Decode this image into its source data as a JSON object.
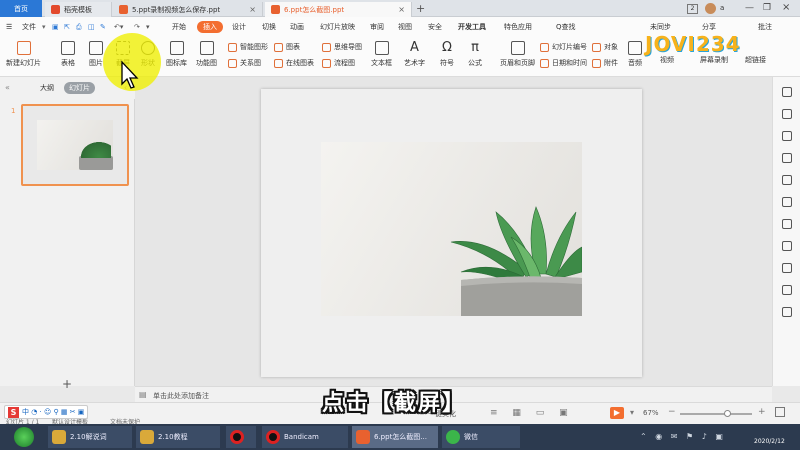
{
  "tabs": {
    "home": "首页",
    "docs": [
      {
        "label": "稻壳模板",
        "color": "#e34a2c"
      },
      {
        "label": "5.ppt录制视频怎么保存.ppt",
        "color": "#e8612f"
      },
      {
        "label": "6.ppt怎么截图.ppt",
        "color": "#e8612f",
        "active": true
      }
    ],
    "new_tab": "+",
    "window_badge": "2",
    "user_initial": "a"
  },
  "menu": {
    "file": "文件",
    "items": [
      "开始",
      "插入",
      "设计",
      "切换",
      "动画",
      "幻灯片放映",
      "审阅",
      "视图",
      "安全",
      "开发工具",
      "特色应用"
    ],
    "active": "插入",
    "search": "Q查找",
    "sync": "未同步",
    "share": "分享",
    "comment": "批注"
  },
  "ribbon": {
    "large": [
      {
        "label": "新建幻灯片",
        "icon": "new-slide-icon"
      },
      {
        "label": "表格",
        "icon": "table-icon"
      },
      {
        "label": "图片",
        "icon": "picture-icon"
      },
      {
        "label": "截屏",
        "icon": "screenshot-icon"
      },
      {
        "label": "形状",
        "icon": "shape-icon"
      },
      {
        "label": "图标库",
        "icon": "icon-library-icon"
      },
      {
        "label": "功能图",
        "icon": "function-chart-icon"
      }
    ],
    "small_col1": [
      "智能图形",
      "关系图"
    ],
    "small_col2": [
      "图表",
      "在线图表"
    ],
    "small_col3": [
      "思维导图",
      "流程图"
    ],
    "mid": [
      {
        "label": "文本框",
        "icon": "textbox-icon"
      },
      {
        "label": "艺术字",
        "icon": "wordart-icon"
      },
      {
        "label": "符号",
        "icon": "omega-icon"
      },
      {
        "label": "公式",
        "icon": "pi-icon"
      },
      {
        "label": "页眉和页脚",
        "icon": "header-footer-icon"
      }
    ],
    "small_col4": [
      "幻灯片编号",
      "日期和时间"
    ],
    "small_col5": [
      "对象",
      "附件"
    ],
    "right": [
      {
        "label": "音频",
        "icon": "audio-icon"
      },
      {
        "label": "视频",
        "icon": "video-icon"
      },
      {
        "label": "屏幕录制",
        "icon": "screen-record-icon"
      },
      {
        "label": "超链接",
        "icon": "hyperlink-icon"
      }
    ]
  },
  "panel": {
    "outline_tab": "大纲",
    "slides_tab": "幻灯片",
    "slide_number": "1",
    "add_button": "+"
  },
  "notes": {
    "placeholder": "单击此处添加备注"
  },
  "status": {
    "slide_info": "幻灯片 1 / 1",
    "theme": "默认设计模板",
    "protect": "文档未保护",
    "beautify": "一键美化",
    "zoom": "67%",
    "zoom_fraction": 0.67
  },
  "caption": "点击【截屏】",
  "logo": "JOVI234",
  "taskbar": {
    "items": [
      {
        "label": "2.10解说词",
        "color": "#d9a93a"
      },
      {
        "label": "2.10教程",
        "color": "#d9a93a"
      },
      {
        "label": "",
        "color": "#d22"
      },
      {
        "label": "Bandicam",
        "color": "#d22"
      },
      {
        "label": "6.ppt怎么截图...",
        "color": "#e8612f"
      },
      {
        "label": "微信",
        "color": "#3bb54a"
      }
    ],
    "date": "2020/2/12"
  },
  "colors": {
    "accent": "#f36e30",
    "home_tab": "#2b78d6",
    "taskbar": "#2c3a4f",
    "thumb_border": "#f0924f"
  }
}
